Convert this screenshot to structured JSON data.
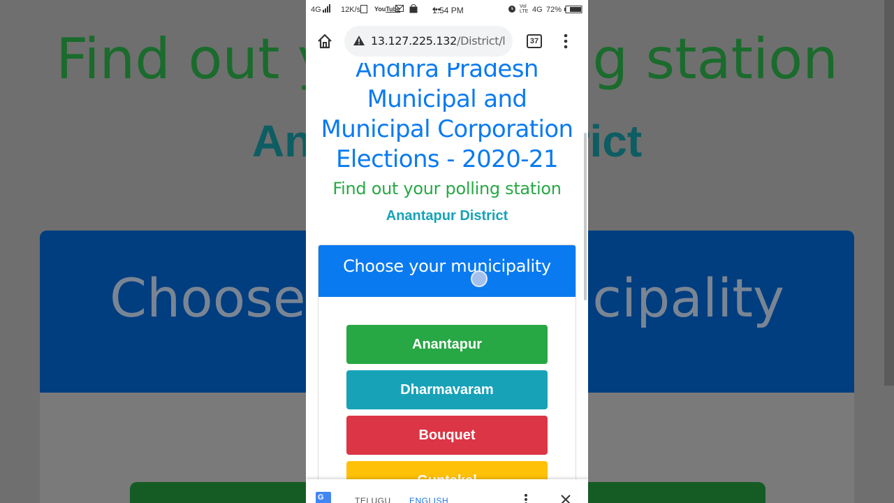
{
  "status_bar": {
    "network": "4G",
    "speed": "12K/s",
    "app_icons": [
      "youtube-icon",
      "mail-icon",
      "bag-icon"
    ],
    "more": "•••",
    "time": "1:54 PM",
    "lte": "4G",
    "battery": "72%"
  },
  "browser": {
    "url_host": "13.127.225.132",
    "url_path": "/District/l",
    "tab_count": "37"
  },
  "page": {
    "title": "Andhra Pradesh Municipal and Municipal Corporation Elections - 2020-21",
    "title_lines": [
      "Andhra Pradesh",
      "Municipal and",
      "Municipal Corporation",
      "Elections - 2020-21"
    ],
    "subtitle": "Find out your polling station",
    "district": "Anantapur District",
    "card_header": "Choose your municipality",
    "municipalities": [
      {
        "label": "Anantapur",
        "color": "#28a745"
      },
      {
        "label": "Dharmavaram",
        "color": "#17a2b8"
      },
      {
        "label": "Bouquet",
        "color": "#dc3545"
      },
      {
        "label": "Guntakal",
        "color": "#ffc107"
      }
    ]
  },
  "background": {
    "title": "Find out your polling station",
    "district": "Anantapur District",
    "card_header": "Choose your municipality"
  },
  "translate_bar": {
    "lang1": "TELUGU",
    "lang2": "ENGLISH"
  }
}
